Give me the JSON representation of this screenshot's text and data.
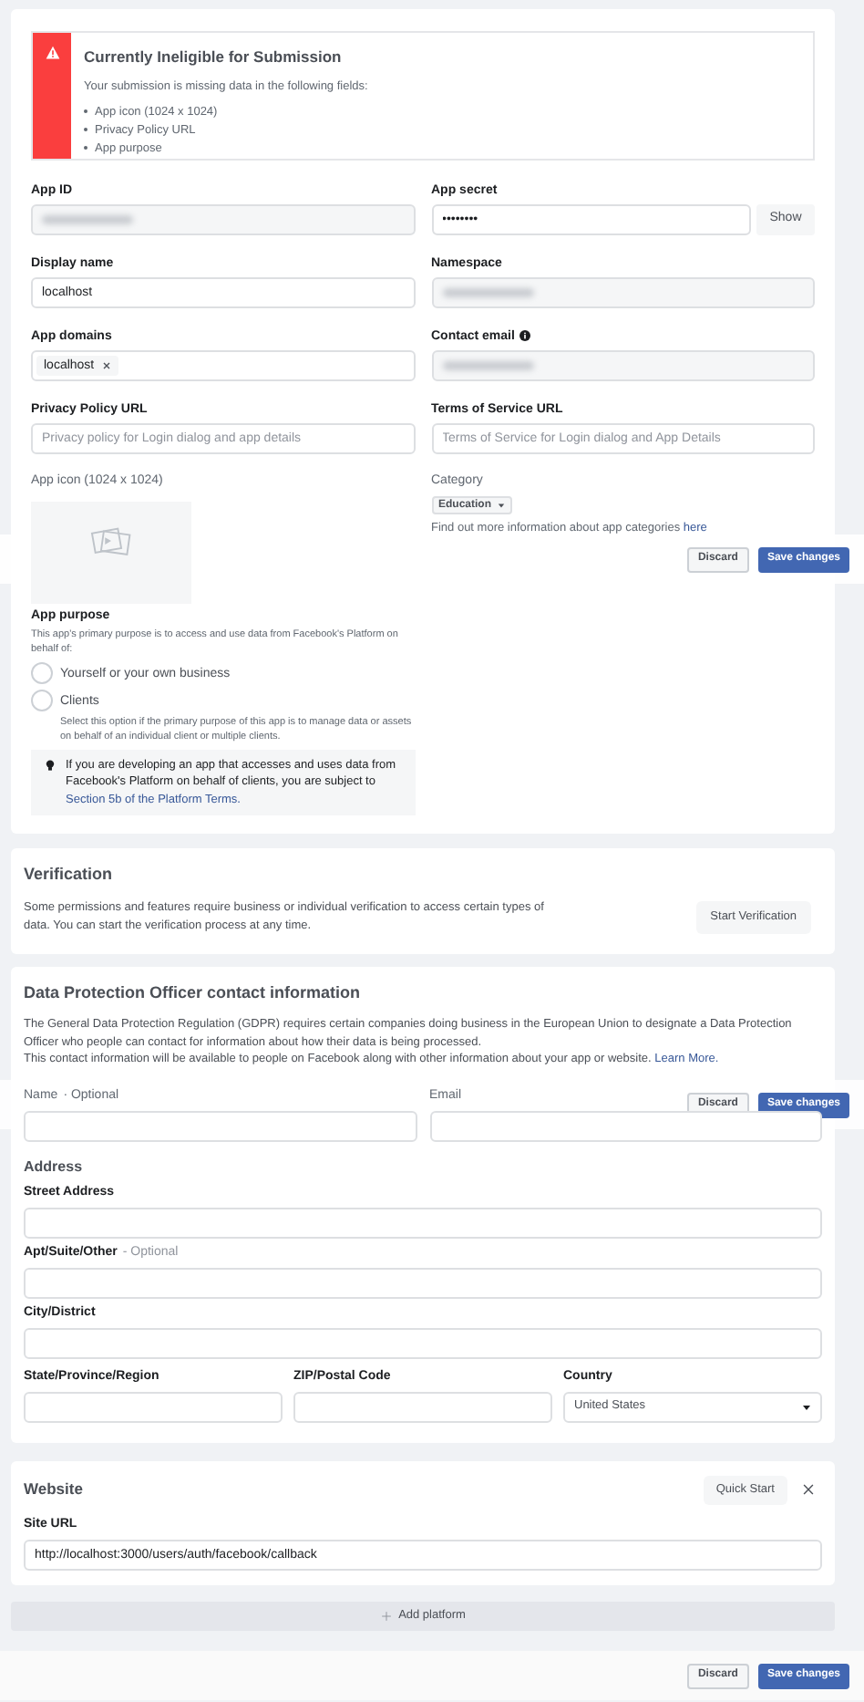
{
  "alert": {
    "title": "Currently Ineligible for Submission",
    "message": "Your submission is missing data in the following fields:",
    "missing_fields": [
      "App icon (1024 x 1024)",
      "Privacy Policy URL",
      "App purpose"
    ]
  },
  "fields": [
    {
      "kind": "redacted",
      "label": "App ID"
    },
    {
      "kind": "secret",
      "label": "App secret",
      "value": "••••••••",
      "button": "Show"
    },
    {
      "kind": "text",
      "label": "Display name",
      "value": "localhost"
    },
    {
      "kind": "redacted",
      "label": "Namespace"
    },
    {
      "kind": "tags",
      "label": "App domains",
      "tags": [
        "localhost"
      ]
    },
    {
      "kind": "redacted",
      "label": "Contact email",
      "info": true
    },
    {
      "kind": "text",
      "label": "Privacy Policy URL",
      "placeholder": "Privacy policy for Login dialog and app details"
    },
    {
      "kind": "text",
      "label": "Terms of Service URL",
      "placeholder": "Terms of Service for Login dialog and App Details"
    }
  ],
  "app_icon": {
    "label": "App icon (1024 x 1024)"
  },
  "category": {
    "label": "Category",
    "value": "Education",
    "note": "Find out more information about app categories",
    "link": "here"
  },
  "app_purpose": {
    "label": "App purpose",
    "description": "This app's primary purpose is to access and use data from Facebook's Platform on behalf of:",
    "options": [
      {
        "label": "Yourself or your own business",
        "selected": false
      },
      {
        "label": "Clients",
        "description": "Select this option if the primary purpose of this app is to manage data or assets on behalf of an individual client or multiple clients.",
        "selected": false
      }
    ],
    "tip": "If you are developing an app that accesses and uses data from Facebook's Platform on behalf of clients, you are subject to",
    "tip_link": "Section 5b of the Platform Terms."
  },
  "verification": {
    "title": "Verification",
    "text": "Some permissions and features require business or individual verification to access certain types of data. You can start the verification process at any time.",
    "button": "Start Verification"
  },
  "dpo": {
    "title": "Data Protection Officer contact information",
    "paragraphs": [
      "The General Data Protection Regulation (GDPR) requires certain companies doing business in the European Union to designate a Data Protection Officer who people can contact for information about how their data is being processed.",
      "This contact information will be available to people on Facebook along with other information about your app or website."
    ],
    "link": "Learn More.",
    "contact_fields": [
      {
        "label": "Name",
        "optional": "· Optional"
      },
      {
        "label": "Email"
      }
    ],
    "address_title": "Address",
    "address_fields": [
      {
        "label": "Street Address"
      },
      {
        "label": "Apt/Suite/Other",
        "optional": "- Optional"
      },
      {
        "label": "City/District"
      }
    ],
    "address_row": [
      {
        "kind": "text",
        "label": "State/Province/Region"
      },
      {
        "kind": "text",
        "label": "ZIP/Postal Code"
      },
      {
        "kind": "select",
        "label": "Country",
        "value": "United States"
      }
    ]
  },
  "website": {
    "title": "Website",
    "button": "Quick Start",
    "site_url_label": "Site URL",
    "site_url": "http://localhost:3000/users/auth/facebook/callback"
  },
  "add_platform": "Add platform",
  "save_bars": [
    {
      "discard": "Discard",
      "save": "Save changes"
    },
    {
      "discard": "Discard",
      "save": "Save changes"
    },
    {
      "discard": "Discard",
      "save": "Save changes"
    }
  ]
}
